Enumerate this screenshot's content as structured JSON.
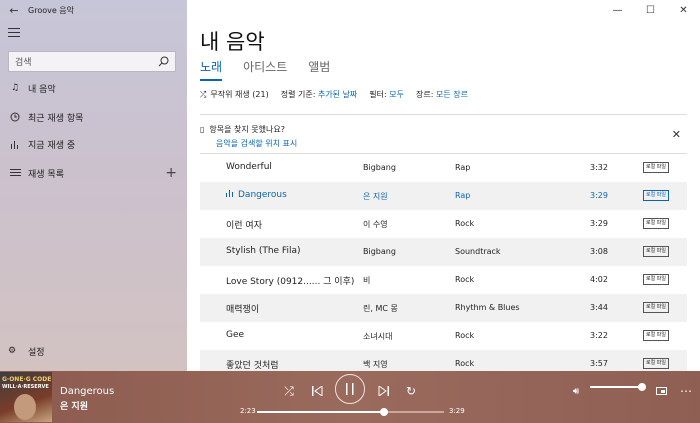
{
  "window": {
    "app_title": "Groove 음악"
  },
  "sidebar": {
    "search_placeholder": "검색",
    "items": [
      {
        "label": "내 음악",
        "icon": "music-note-icon"
      },
      {
        "label": "최근 재생 항목",
        "icon": "clock-icon"
      },
      {
        "label": "지금 재생 중",
        "icon": "equalizer-icon"
      },
      {
        "label": "재생 목록",
        "icon": "playlist-icon"
      }
    ],
    "settings_label": "설정"
  },
  "main": {
    "title": "내 음악",
    "tabs": [
      {
        "label": "노래",
        "active": true
      },
      {
        "label": "아티스트",
        "active": false
      },
      {
        "label": "앨범",
        "active": false
      }
    ],
    "filters": {
      "shuffle_label": "무작위 재생 (21)",
      "sort_label": "정렬 기준:",
      "sort_value": "추가된 날짜",
      "filter_label": "필터:",
      "filter_value": "모두",
      "genre_label": "장르:",
      "genre_value": "모든 장르"
    },
    "notice": {
      "message": "항목을 찾지 못했나요?",
      "link": "음악을 검색할 위치 표시"
    },
    "songs": [
      {
        "title": "Wonderful",
        "artist": "Bigbang",
        "genre": "Rap",
        "duration": "3:32",
        "badge": "로컬 파일",
        "playing": false
      },
      {
        "title": "Dangerous",
        "artist": "은 지원",
        "genre": "Rap",
        "duration": "3:29",
        "badge": "로컬 파일",
        "playing": true
      },
      {
        "title": "이런 여자",
        "artist": "이 수영",
        "genre": "Rock",
        "duration": "3:29",
        "badge": "로컬 파일",
        "playing": false
      },
      {
        "title": "Stylish (The Fila)",
        "artist": "Bigbang",
        "genre": "Soundtrack",
        "duration": "3:08",
        "badge": "로컬 파일",
        "playing": false
      },
      {
        "title": "Love Story (0912...... 그 이후)",
        "artist": "비",
        "genre": "Rock",
        "duration": "4:02",
        "badge": "로컬 파일",
        "playing": false
      },
      {
        "title": "매력쟁이",
        "artist": "린, MC 몽",
        "genre": "Rhythm & Blues",
        "duration": "3:44",
        "badge": "로컬 파일",
        "playing": false
      },
      {
        "title": "Gee",
        "artist": "소녀시대",
        "genre": "Rock",
        "duration": "3:22",
        "badge": "로컬 파일",
        "playing": false
      },
      {
        "title": "좋았던 것처럼",
        "artist": "백 지영",
        "genre": "Rock",
        "duration": "3:57",
        "badge": "로컬 파일",
        "playing": false
      }
    ]
  },
  "player": {
    "track_title": "Dangerous",
    "track_artist": "은 지원",
    "elapsed": "2:23",
    "total": "3:29",
    "progress": 0.68,
    "volume": 1.0,
    "album_art_text_1": "G·ONE·G CODE",
    "album_art_text_2": "WILL·A·RESERVE"
  }
}
